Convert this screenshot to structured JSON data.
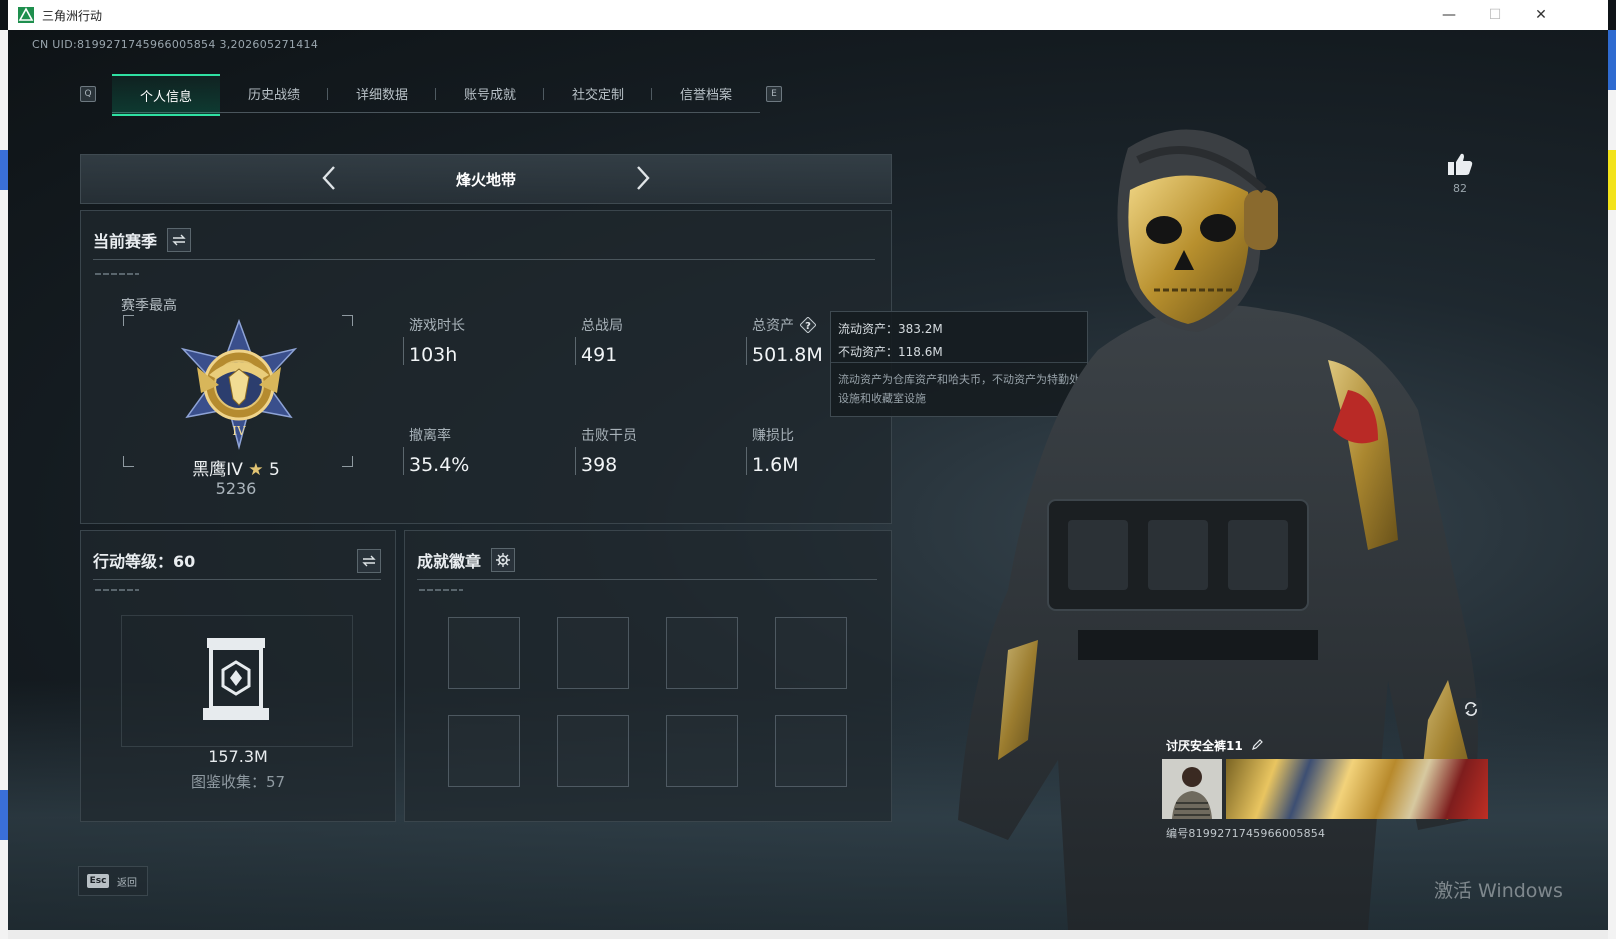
{
  "window": {
    "title": "三角洲行动",
    "minimize": "—",
    "maximize": "☐",
    "close": "✕"
  },
  "uid": "CN UID:8199271745966005854 3,202605271414",
  "tabs": {
    "left_key": "Q",
    "right_key": "E",
    "items": [
      {
        "label": "个人信息",
        "active": true
      },
      {
        "label": "历史战绩"
      },
      {
        "label": "详细数据"
      },
      {
        "label": "账号成就"
      },
      {
        "label": "社交定制"
      },
      {
        "label": "信誉档案"
      }
    ]
  },
  "mode": {
    "title": "烽火地带"
  },
  "season": {
    "title": "当前赛季",
    "best_label": "赛季最高",
    "rank_name": "黑鹰IV",
    "rank_star": "★",
    "rank_stars": "5",
    "rank_score": "5236",
    "stats": [
      {
        "label": "游戏时长",
        "value": "103h"
      },
      {
        "label": "总战局",
        "value": "491"
      },
      {
        "label": "总资产",
        "value": "501.8M",
        "help": true
      },
      {
        "label": "撤离率",
        "value": "35.4%"
      },
      {
        "label": "击败干员",
        "value": "398"
      },
      {
        "label": "赚损比",
        "value": "1.6M"
      }
    ]
  },
  "tooltip": {
    "liquid": "流动资产：383.2M",
    "fixed": "不动资产：118.6M",
    "desc": "流动资产为仓库资产和哈夫币，不动资产为特勤处设施和收藏室设施"
  },
  "level": {
    "title": "行动等级：60",
    "value": "157.3M",
    "collection": "图鉴收集：57"
  },
  "badges": {
    "title": "成就徽章"
  },
  "likes": {
    "count": "82"
  },
  "card": {
    "name": "讨厌安全裤11",
    "id": "编号8199271745966005854"
  },
  "esc": {
    "key": "Esc",
    "label": "返回"
  },
  "os_watermark": "激活 Windows",
  "colors": {
    "accent": "#2fe0a2",
    "gold": "#c9a13b"
  }
}
